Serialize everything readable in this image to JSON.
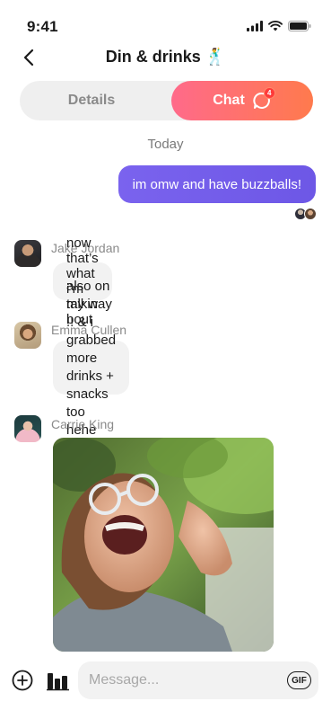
{
  "status_bar": {
    "time": "9:41",
    "icons": [
      "signal-icon",
      "wifi-icon",
      "battery-icon"
    ]
  },
  "header": {
    "back_icon": "chevron-left-icon",
    "title": "Din & drinks",
    "title_emoji": "🕺"
  },
  "segmented": {
    "details_label": "Details",
    "chat_label": "Chat",
    "chat_badge": "4",
    "active": "Chat",
    "accent_gradient": [
      "#ff6a8a",
      "#ff7a4d"
    ]
  },
  "chat": {
    "date_separator": "Today",
    "outgoing": [
      {
        "text": "im omw and have buzzballs!",
        "color": "#7a63ee"
      }
    ],
    "incoming": [
      {
        "sender": "Jake Jordan",
        "text": "now that’s what i’m talkin bout"
      },
      {
        "sender": "Emma Cullen",
        "text_line1": "also on my way !! & i grabbed",
        "text_line2": "more drinks + snacks too hehe 🤭"
      },
      {
        "sender": "Carrie King",
        "attachment": "photo"
      }
    ]
  },
  "composer": {
    "add_icon": "plus-circle-icon",
    "poll_icon": "bar-chart-icon",
    "placeholder": "Message...",
    "gif_label": "GIF"
  }
}
